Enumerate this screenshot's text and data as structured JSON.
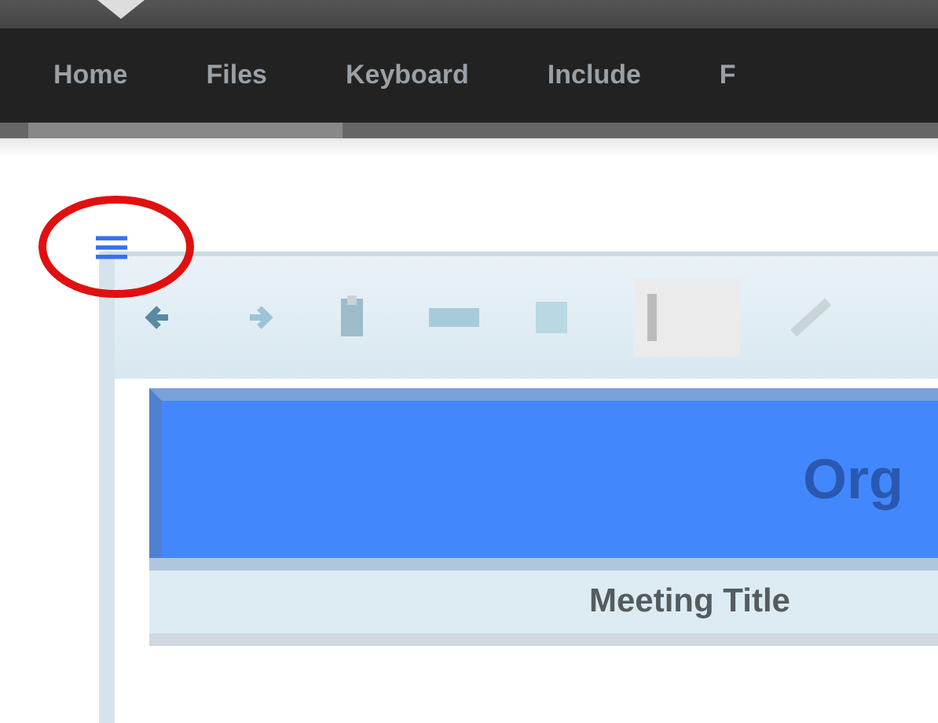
{
  "nav": {
    "items": [
      {
        "label": "Home"
      },
      {
        "label": "Files"
      },
      {
        "label": "Keyboard"
      },
      {
        "label": "Include"
      },
      {
        "label": "F"
      }
    ]
  },
  "menu_icon": {
    "highlighted": true
  },
  "editor": {
    "banner_title": "Org",
    "column_header": "Meeting Title"
  }
}
